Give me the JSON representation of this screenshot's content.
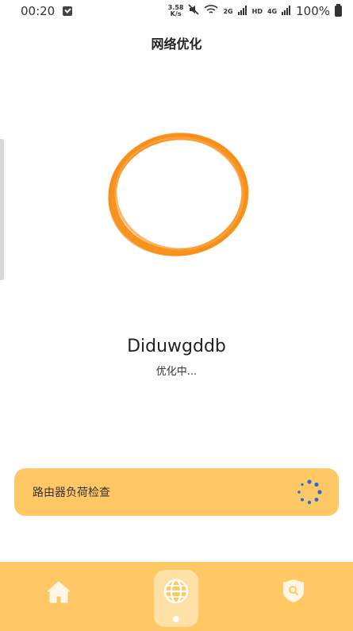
{
  "status_bar": {
    "time": "00:20",
    "net_speed_value": "3.58",
    "net_speed_unit": "K/s",
    "signal_2g": "2G",
    "hd_label": "HD",
    "signal_4g": "4G",
    "battery": "100%"
  },
  "header": {
    "title": "网络优化"
  },
  "main": {
    "device_name": "Diduwgddb",
    "status": "优化中..."
  },
  "task": {
    "label": "路由器负荷检查"
  },
  "colors": {
    "accent": "#ffc864",
    "ring": "#f7931e",
    "spinner": "#1e6fd9",
    "nav_active_bg": "#ffe0a6"
  },
  "bottom_nav": {
    "icons": [
      "home-icon",
      "globe-icon",
      "shield-search-icon"
    ],
    "active_index": 1
  }
}
